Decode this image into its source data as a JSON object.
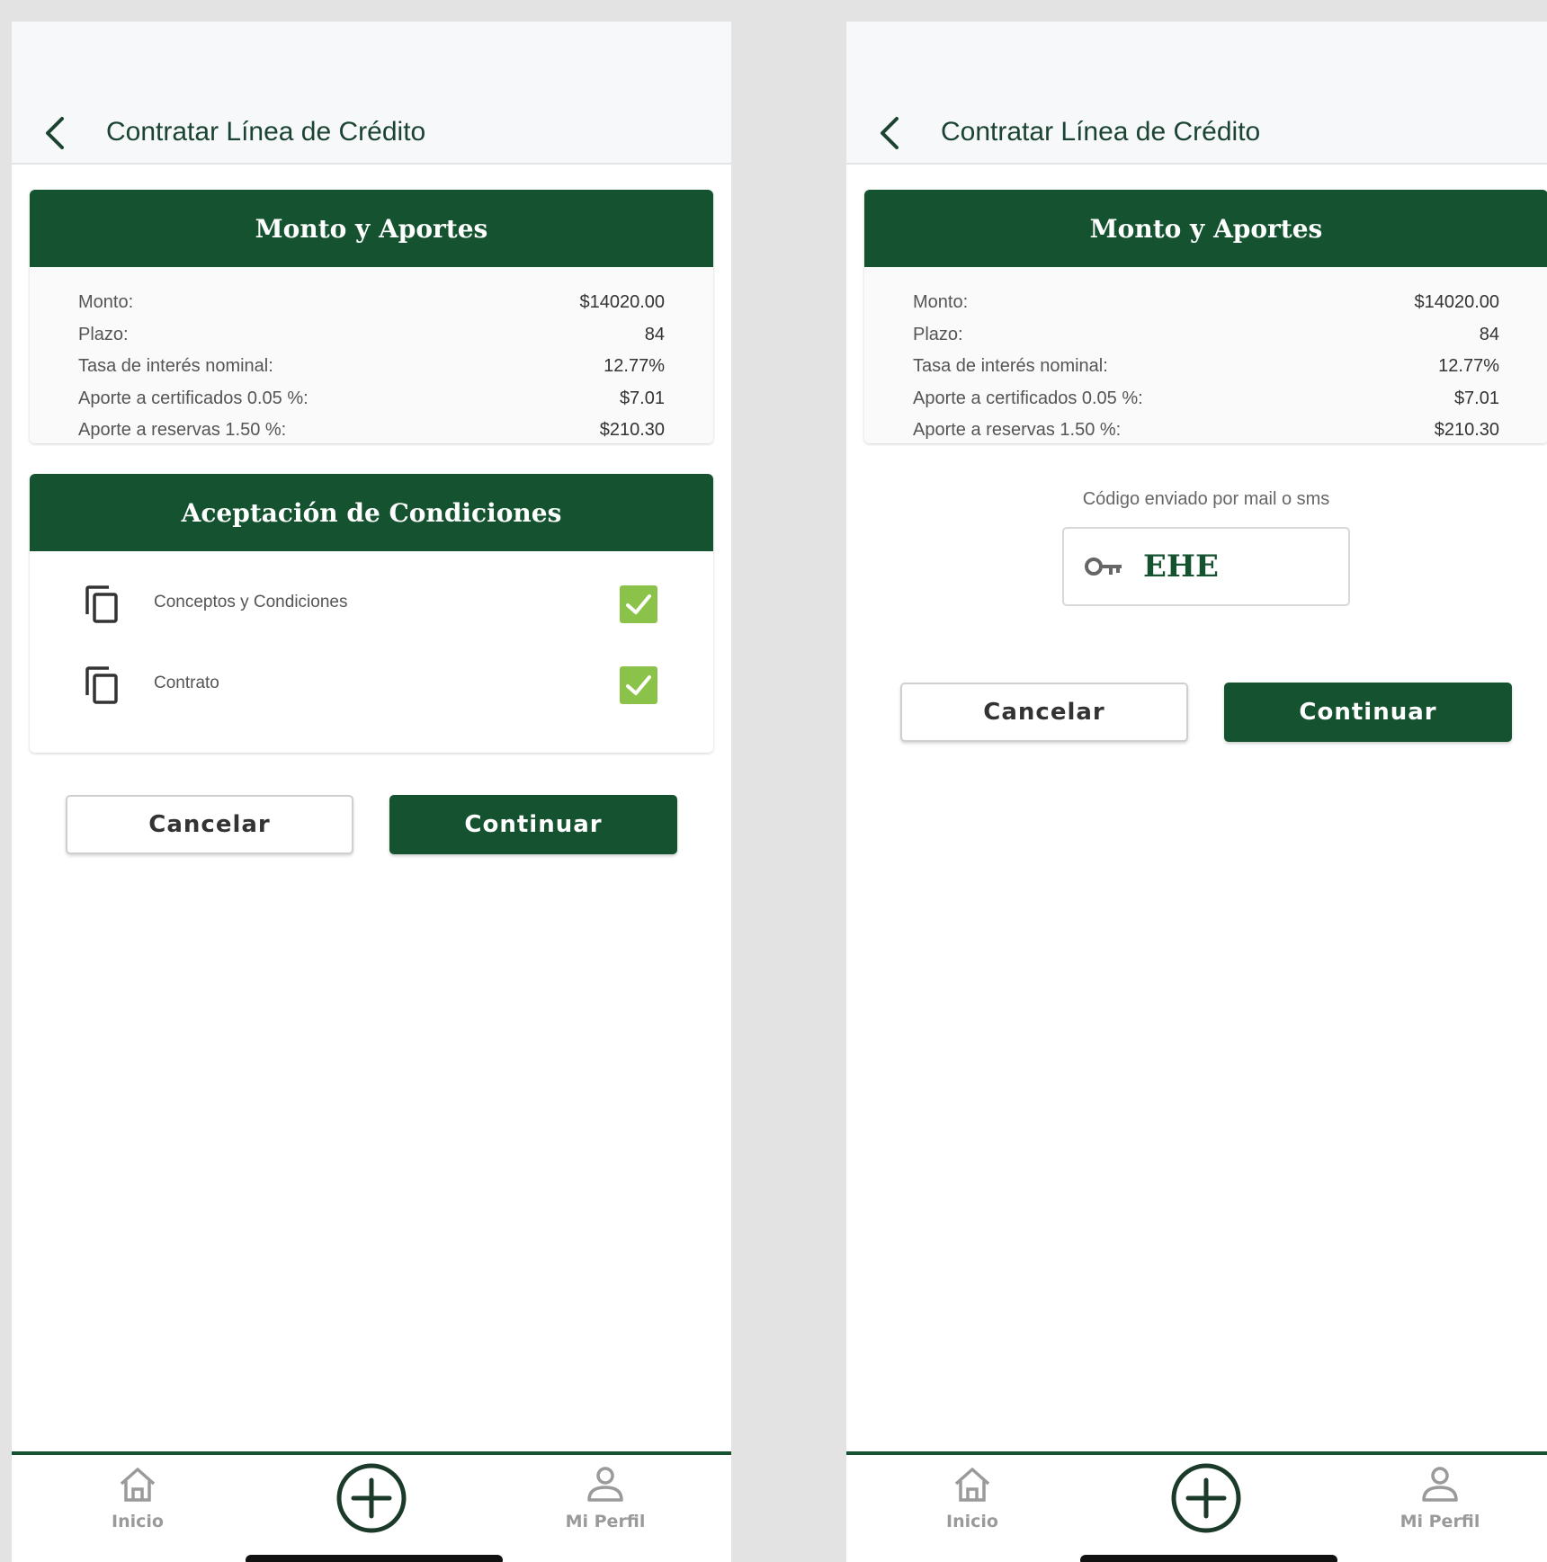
{
  "header": {
    "title": "Contratar Línea de Crédito"
  },
  "summary": {
    "title": "Monto y Aportes",
    "rows": [
      {
        "label": "Monto:",
        "value": "$14020.00"
      },
      {
        "label": "Plazo:",
        "value": "84"
      },
      {
        "label": "Tasa de interés nominal:",
        "value": "12.77%"
      },
      {
        "label": "Aporte a certificados 0.05 %:",
        "value": "$7.01"
      },
      {
        "label": "Aporte a reservas 1.50 %:",
        "value": "$210.30"
      }
    ]
  },
  "conditions": {
    "title": "Aceptación de Condiciones",
    "items": [
      {
        "label": "Conceptos y Condiciones",
        "checked": true
      },
      {
        "label": "Contrato",
        "checked": true
      }
    ]
  },
  "code": {
    "label": "Código enviado por mail o sms",
    "value": "EHE"
  },
  "buttons": {
    "cancel": "Cancelar",
    "continue": "Continuar"
  },
  "nav": {
    "home": "Inicio",
    "profile": "Mi Perfil"
  },
  "colors": {
    "brand": "#145230",
    "check": "#8bc34a",
    "background": "#e3e3e3"
  },
  "icons": [
    "back-arrow",
    "copy-document",
    "checkbox-checked",
    "key",
    "home",
    "plus-circle",
    "user"
  ]
}
